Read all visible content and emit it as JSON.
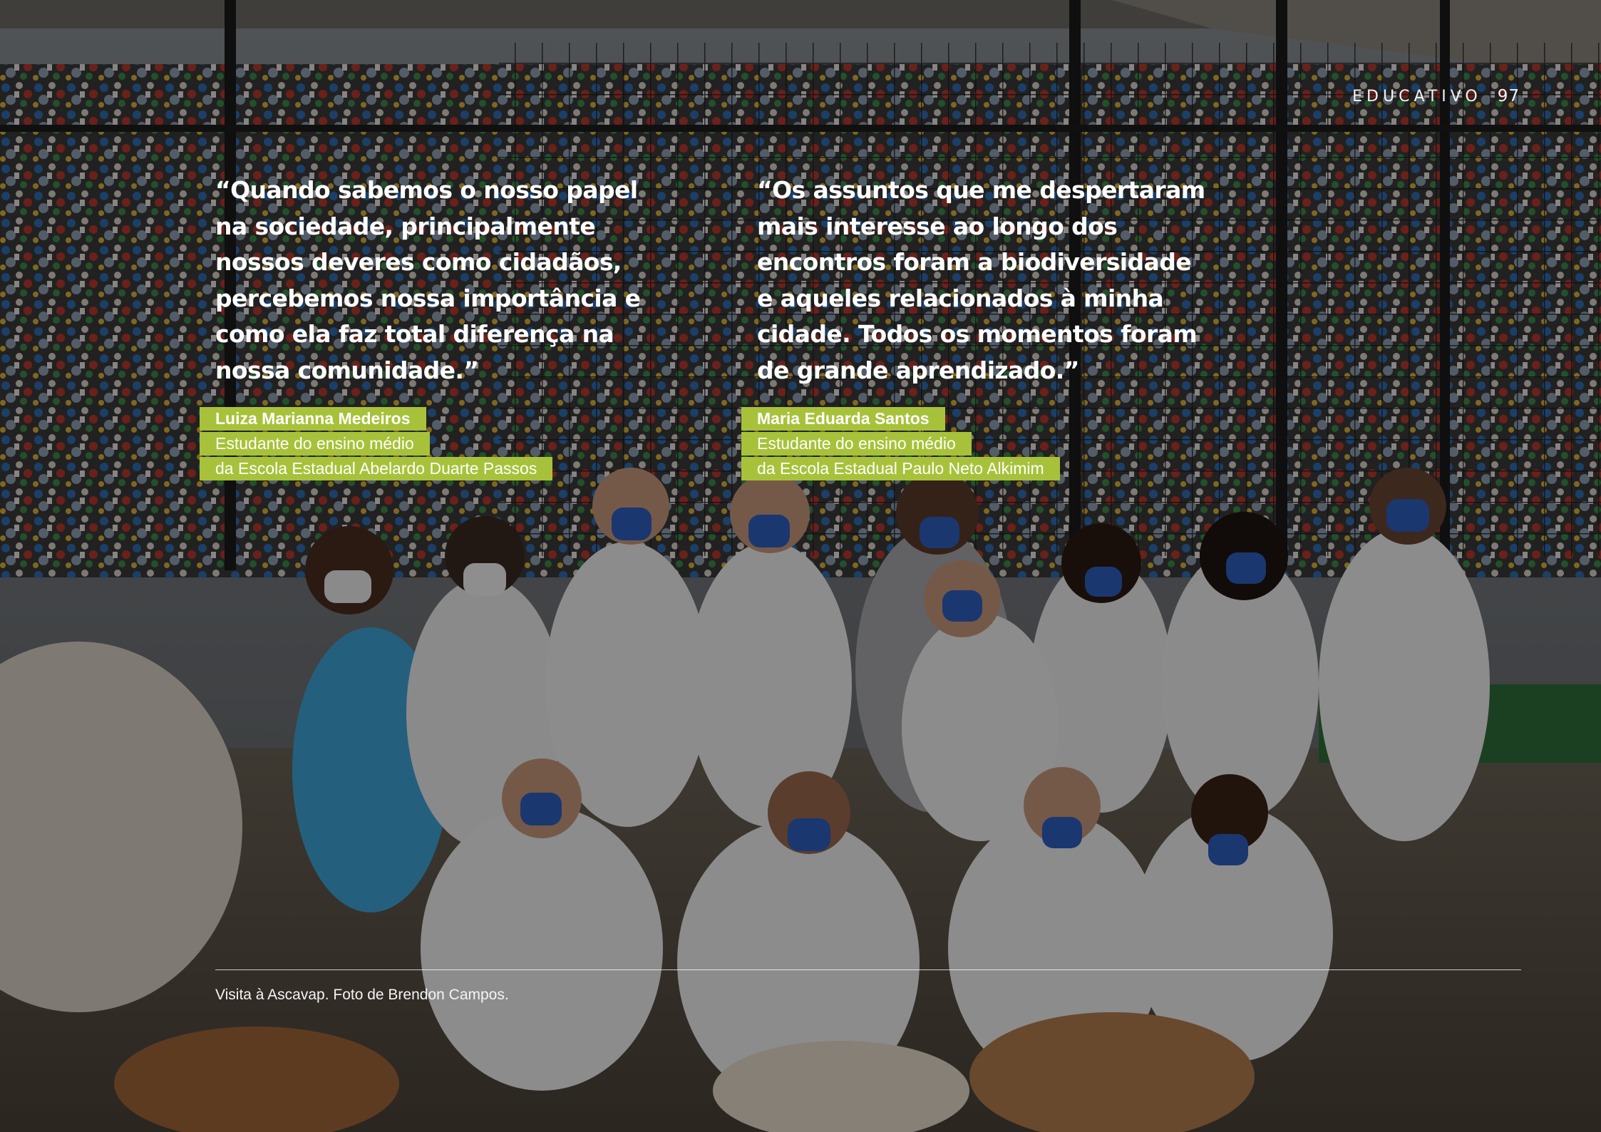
{
  "header": {
    "section": "EDUCATIVO",
    "page_number": "97"
  },
  "quotes": [
    {
      "text": "“Quando sabemos o nosso papel na sociedade, principalmente nossos deveres como cidadãos, percebemos nossa importância e como ela faz total diferença na nossa comunidade.”",
      "name": "Luiza Marianna Medeiros",
      "role": "Estudante do ensino médio",
      "school": "da Escola Estadual Abelardo Duarte Passos"
    },
    {
      "text": "“Os assuntos que me despertaram mais interesse ao longo dos encontros foram a biodiversidade e aqueles relacionados à minha cidade. Todos os momentos foram de grande aprendizado.”",
      "name": "Maria Eduarda Santos",
      "role": "Estudante do ensino médio",
      "school": "da Escola Estadual Paulo Neto Alkimim"
    }
  ],
  "caption": "Visita à Ascavap. Foto de Brendon Campos.",
  "colors": {
    "accent": "#a7c23a",
    "mask": "#2f5fbf"
  }
}
